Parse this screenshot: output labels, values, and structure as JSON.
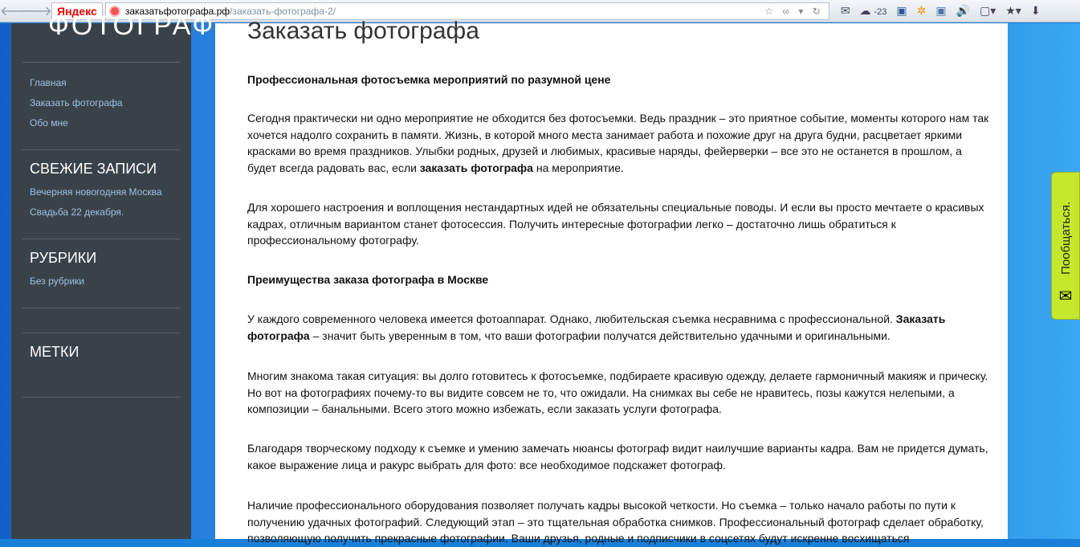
{
  "browser": {
    "yandex_label": "Яндекс",
    "url_domain": "заказатьфотографа.рф",
    "url_path": "/заказать-фотографа-2/",
    "weather": "-23"
  },
  "sidebar": {
    "logo": "ФОТОГРАФ",
    "nav": [
      "Главная",
      "Заказать фотографа",
      "Обо мне"
    ],
    "recent_title": "СВЕЖИЕ ЗАПИСИ",
    "recent": [
      "Вечерняя новогодняя Москва",
      "Свадьба 22 декабря."
    ],
    "categories_title": "РУБРИКИ",
    "categories": [
      "Без рубрики"
    ],
    "tags_title": "МЕТКИ"
  },
  "main": {
    "title": "Заказать фотографа",
    "h1": "Профессиональная фотосъемка мероприятий по разумной цене",
    "p1a": " Сегодня практически ни одно мероприятие не обходится без фотосъемки. Ведь праздник – это приятное событие, моменты которого нам так хочется надолго сохранить в памяти. Жизнь, в которой много места занимает работа и похожие друг на друга будни, расцветает яркими красками во время праздников. Улыбки родных, друзей и любимых, красивые наряды, фейерверки – все это не останется в прошлом, а будет всегда радовать вас, если ",
    "p1b": "заказать фотографа",
    "p1c": " на мероприятие.",
    "p2": "Для хорошего настроения и воплощения нестандартных идей не обязательны специальные поводы. И если вы просто мечтаете о красивых кадрах, отличным вариантом станет фотосессия. Получить интересные фотографии легко – достаточно лишь обратиться к профессиональному фотографу.",
    "h2": "Преимущества заказа фотографа в Москве",
    "p3a": " У каждого современного человека имеется фотоаппарат. Однако, любительская съемка несравнима с профессиональной. ",
    "p3b": "Заказать фотографа",
    "p3c": " – значит быть уверенным в том, что ваши фотографии получатся действительно удачными и оригинальными.",
    "p4": "Многим знакома такая ситуация: вы долго готовитесь к фотосъемке, подбираете красивую одежду, делаете гармоничный макияж и прическу. Но вот на фотографиях почему-то вы видите совсем не то, что ожидали. На снимках вы себе не нравитесь, позы кажутся нелепыми, а композиции – банальными. Всего этого можно избежать, если заказать  услуги фотографа.",
    "p5": "Благодаря творческому подходу к съемке и умению замечать нюансы фотограф видит наилучшие варианты кадра. Вам не придется думать, какое выражение лица и ракурс выбрать для фото: все необходимое подскажет фотограф.",
    "p6": "Наличие профессионального оборудования позволяет получать кадры высокой четкости. Но съемка – только начало работы по пути к получению удачных фотографий. Следующий этап – это тщательная обработка снимков. Профессиональный фотограф сделает обработку, позволяющую получить прекрасные фотографии. Ваши друзья, родные и подписчики в соцсетях будут искренне восхищаться"
  },
  "share": {
    "label": "Пообщаться."
  }
}
